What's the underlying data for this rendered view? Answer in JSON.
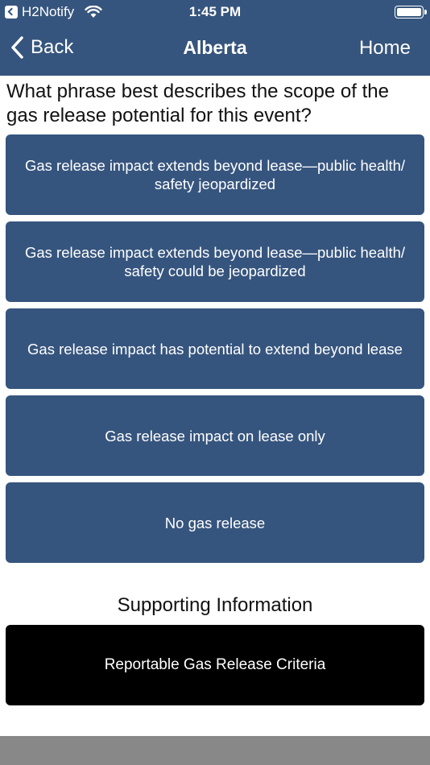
{
  "status_bar": {
    "app_name": "H2Notify",
    "time": "1:45 PM",
    "icons": [
      "back-to-app-icon",
      "wifi-icon",
      "battery-icon"
    ]
  },
  "nav": {
    "back_label": "Back",
    "title": "Alberta",
    "home_label": "Home"
  },
  "question": "What phrase best describes the scope of the gas release potential for this event?",
  "options": [
    {
      "label": "Gas release impact extends beyond lease—public health/ safety jeopardized"
    },
    {
      "label": "Gas release impact extends beyond lease—public health/ safety could be jeopardized"
    },
    {
      "label": "Gas release impact has potential to extend beyond lease"
    },
    {
      "label": "Gas release impact on lease only"
    },
    {
      "label": "No gas release"
    }
  ],
  "supporting": {
    "heading": "Supporting Information",
    "button_label": "Reportable Gas Release Criteria"
  },
  "colors": {
    "header": "#36557e",
    "option_button": "#36557e",
    "support_button": "#000000",
    "bottom_bar": "#888888"
  }
}
